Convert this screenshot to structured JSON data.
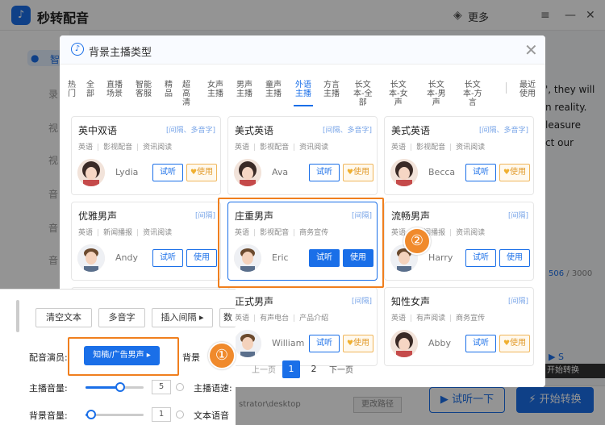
{
  "app": {
    "title": "秒转配音",
    "more": "更多"
  },
  "sidebar": {
    "items": [
      "智",
      "录",
      "视",
      "视",
      "音",
      "音",
      "音"
    ]
  },
  "background": {
    "right_text": [
      "', they will",
      "n reality.",
      "leasure",
      "ct our"
    ],
    "counter_value": "506",
    "counter_total": " / 3000",
    "player": "▶ S",
    "tip": "开始转换"
  },
  "bottom": {
    "path": "strator\\desktop",
    "change_path": "更改路径",
    "try_listen": "试听一下",
    "start": "开始转换"
  },
  "modal": {
    "title": "背景主播类型",
    "tabs": [
      {
        "label": "热\n门"
      },
      {
        "label": "全\n部"
      },
      {
        "label": "直播\n场景"
      },
      {
        "label": "智能\n客服"
      },
      {
        "label": "精\n品"
      },
      {
        "label": "超\n高\n清"
      },
      {
        "label": "女声\n主播"
      },
      {
        "label": "男声\n主播"
      },
      {
        "label": "童声\n主播"
      },
      {
        "label": "外语\n主播"
      },
      {
        "label": "方言\n主播"
      },
      {
        "label": "长文\n本-全\n部"
      },
      {
        "label": "长文\n本-女\n声"
      },
      {
        "label": "长文\n本-男\n声"
      },
      {
        "label": "长文\n本-方\n言"
      },
      {
        "label": "最近\n使用"
      }
    ],
    "cards": [
      {
        "name": "英中双语",
        "tag": "[间隔、多音字]",
        "attrs": [
          "英语",
          "影视配音",
          "资讯阅读"
        ],
        "voice": "Lydia",
        "listen": "试听",
        "use": "使用",
        "vip": true,
        "avatar": "female"
      },
      {
        "name": "美式英语",
        "tag": "[间隔、多音字]",
        "attrs": [
          "英语",
          "影视配音",
          "资讯阅读"
        ],
        "voice": "Ava",
        "listen": "试听",
        "use": "使用",
        "vip": true,
        "avatar": "female"
      },
      {
        "name": "美式英语",
        "tag": "[间隔、多音字]",
        "attrs": [
          "英语",
          "影视配音",
          "资讯阅读"
        ],
        "voice": "Becca",
        "listen": "试听",
        "use": "使用",
        "vip": true,
        "avatar": "female"
      },
      {
        "name": "优雅男声",
        "tag": "[间隔]",
        "attrs": [
          "英语",
          "新闻播报",
          "资讯阅读"
        ],
        "voice": "Andy",
        "listen": "试听",
        "use": "使用",
        "vip": false,
        "avatar": "male"
      },
      {
        "name": "庄重男声",
        "tag": "[间隔]",
        "attrs": [
          "英语",
          "影视配音",
          "商务宣传"
        ],
        "voice": "Eric",
        "listen": "试听",
        "use": "使用",
        "vip": false,
        "avatar": "male"
      },
      {
        "name": "流畅男声",
        "tag": "[间隔]",
        "attrs": [
          "英语",
          "新闻播报",
          "资讯阅读"
        ],
        "voice": "Harry",
        "listen": "试听",
        "use": "使用",
        "vip": false,
        "avatar": "male"
      },
      {
        "name": "",
        "tag": "",
        "attrs": [],
        "voice": "",
        "listen": "",
        "use": "",
        "vip": false,
        "avatar": "none"
      },
      {
        "name": "正式男声",
        "tag": "[间隔]",
        "attrs": [
          "英语",
          "有声电台",
          "产品介绍"
        ],
        "voice": "William",
        "listen": "试听",
        "use": "使用",
        "vip": true,
        "avatar": "male"
      },
      {
        "name": "知性女声",
        "tag": "[间隔]",
        "attrs": [
          "英语",
          "有声阅读",
          "商务宣传"
        ],
        "voice": "Abby",
        "listen": "试听",
        "use": "使用",
        "vip": true,
        "avatar": "female"
      }
    ],
    "pager": {
      "prev": "上一页",
      "p1": "1",
      "p2": "2",
      "next": "下一页"
    }
  },
  "inset": {
    "clear": "清空文本",
    "polyphone": "多音字",
    "insert_pause": "插入间隔 ▸",
    "more": "数",
    "actor_label": "配音演员:",
    "actor_button": "知楠/广告男声 ▸",
    "bg_label": "背景",
    "host_volume_label": "主播音量:",
    "host_volume_value": "5",
    "host_volume_level": 0.6,
    "speed_label": "主播语速:",
    "bg_volume_label": "背景音量:",
    "bg_volume_value": "1",
    "bg_volume_level": 0.1,
    "text_label": "文本语音"
  },
  "markers": {
    "one": "①",
    "two": "②"
  },
  "colors": {
    "accent": "#1a6fe8",
    "highlight": "#f07f1e"
  }
}
